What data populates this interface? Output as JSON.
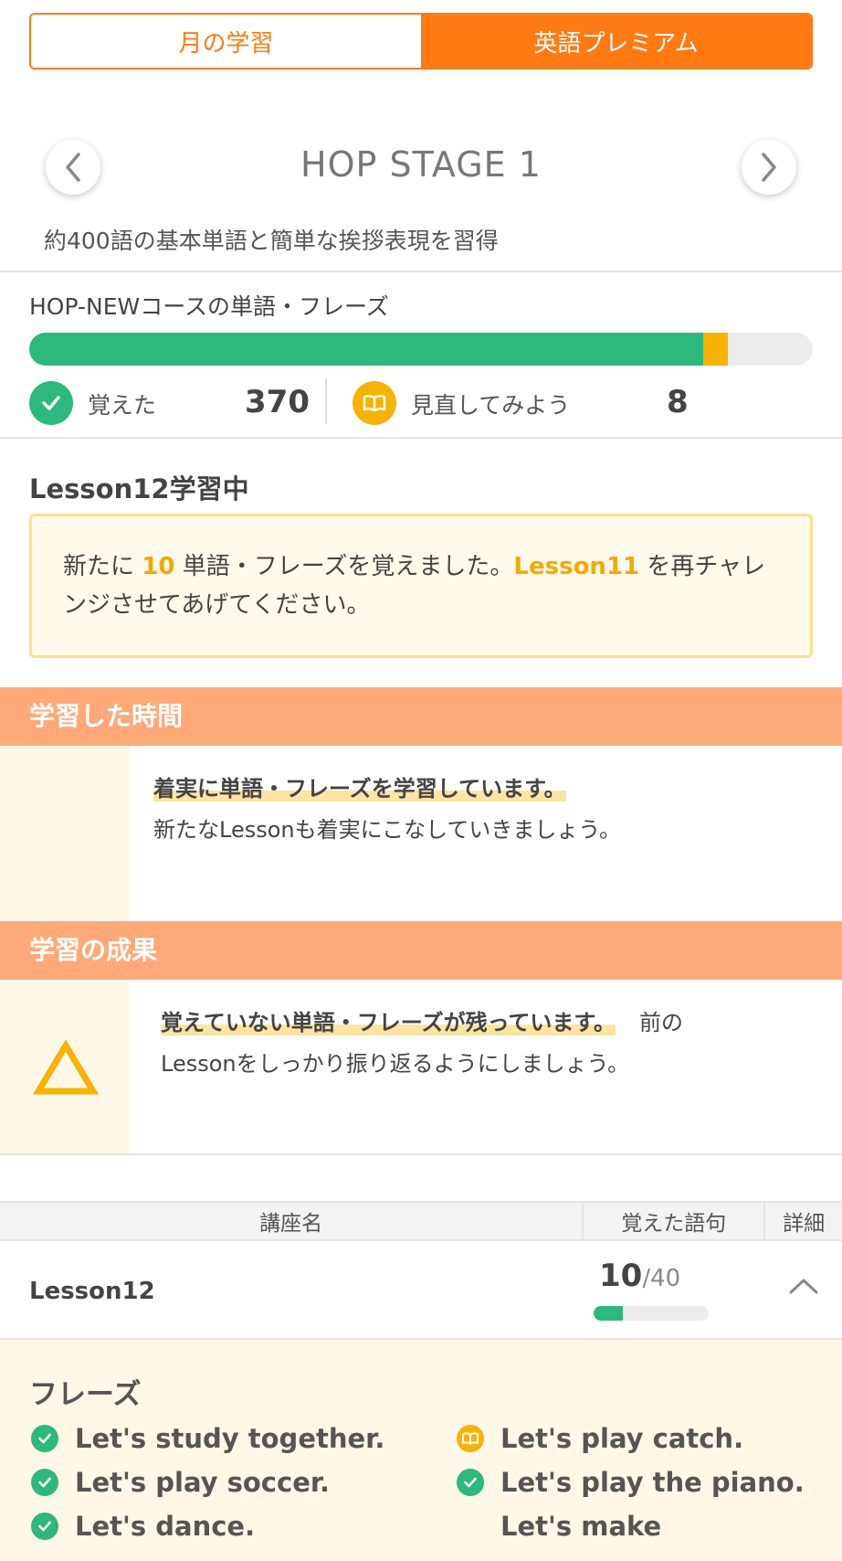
{
  "tabs": {
    "left": "月の学習",
    "right": "英語プレミアム"
  },
  "stage": {
    "title": "HOP STAGE 1",
    "description": "約400語の基本単語と簡単な挨拶表現を習得"
  },
  "course": {
    "title": "HOP-NEWコースの単語・フレーズ",
    "progress": {
      "learned_fraction": 0.86,
      "review_fraction": 0.032
    },
    "learned_label": "覚えた",
    "learned_count": "370",
    "review_label": "見直してみよう",
    "review_count": "8"
  },
  "lesson_status": "Lesson12学習中",
  "notice": {
    "part1": "新たに ",
    "count": "10",
    "part2": " 単語・フレーズを覚えました。",
    "lesson": "Lesson11",
    "part3": " を再チャレンジさせてあげてください。"
  },
  "study_time": {
    "heading": "学習した時間",
    "highlight": "着実に単語・フレーズを学習しています。",
    "text": "新たなLessonも着実にこなしていきましょう。"
  },
  "result": {
    "heading": "学習の成果",
    "highlight": "覚えていない単語・フレーズが残っています。",
    "text_a": "前の",
    "text_b": "Lessonをしっかり振り返るようにしましょう。"
  },
  "table": {
    "headers": [
      "講座名",
      "覚えた語句",
      "詳細"
    ],
    "row": {
      "name": "Lesson12",
      "learned": "10",
      "total": "/40",
      "fraction": 0.25
    }
  },
  "phrases": {
    "title": "フレーズ",
    "left": [
      {
        "text": "Let's study together.",
        "status": "learned"
      },
      {
        "text": "Let's play soccer.",
        "status": "learned"
      },
      {
        "text": "Let's dance.",
        "status": "learned"
      }
    ],
    "right": [
      {
        "text": "Let's play catch.",
        "status": "review"
      },
      {
        "text": "Let's play the piano.",
        "status": "learned"
      },
      {
        "text": "Let's make",
        "status": "none"
      }
    ]
  },
  "colors": {
    "accent": "#ff7a12",
    "green": "#2db87d",
    "yellow": "#f7b300",
    "section": "#ffa979"
  },
  "icons": {
    "prev": "chevron-left-icon",
    "next": "chevron-right-icon",
    "learned": "check-icon",
    "review": "book-icon",
    "result": "triangle-icon",
    "collapse": "chevron-up-icon"
  }
}
